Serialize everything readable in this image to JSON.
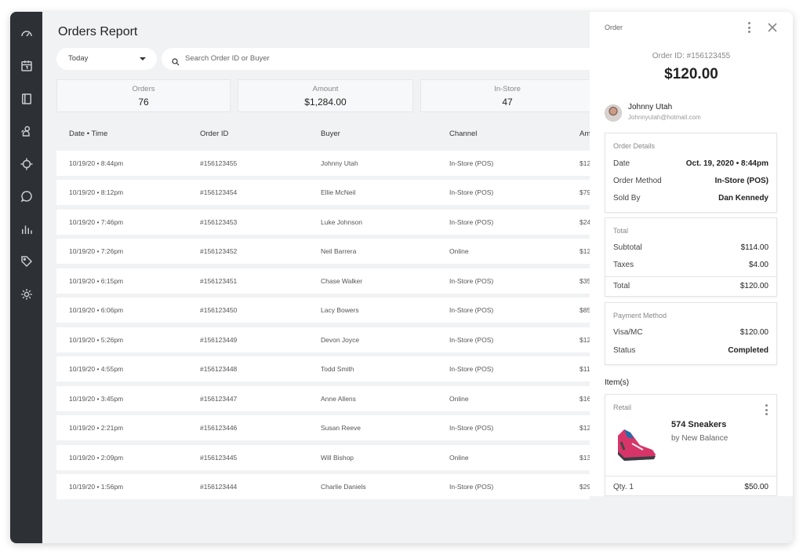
{
  "sidebar": {
    "items": [
      {
        "icon": "dashboard-icon"
      },
      {
        "icon": "calendar-icon"
      },
      {
        "icon": "book-icon"
      },
      {
        "icon": "users-icon"
      },
      {
        "icon": "target-icon"
      },
      {
        "icon": "chat-icon"
      },
      {
        "icon": "bar-chart-icon"
      },
      {
        "icon": "tag-icon"
      },
      {
        "icon": "gear-icon"
      }
    ]
  },
  "page": {
    "title": "Orders Report",
    "date_filter": "Today",
    "search_placeholder": "Search Order ID or Buyer"
  },
  "stats": [
    {
      "label": "Orders",
      "value": "76"
    },
    {
      "label": "Amount",
      "value": "$1,284.00"
    },
    {
      "label": "In-Store",
      "value": "47"
    }
  ],
  "table": {
    "columns": [
      "Date • Time",
      "Order ID",
      "Buyer",
      "Channel",
      "Am"
    ],
    "rows": [
      {
        "datetime": "10/19/20 • 8:44pm",
        "order_id": "#156123455",
        "buyer": "Johnny Utah",
        "channel": "In-Store (POS)",
        "amount": "$12"
      },
      {
        "datetime": "10/19/20 • 8:12pm",
        "order_id": "#156123454",
        "buyer": "Ellie McNeil",
        "channel": "In-Store (POS)",
        "amount": "$79"
      },
      {
        "datetime": "10/19/20 • 7:46pm",
        "order_id": "#156123453",
        "buyer": "Luke Johnson",
        "channel": "In-Store (POS)",
        "amount": "$24"
      },
      {
        "datetime": "10/19/20 • 7:26pm",
        "order_id": "#156123452",
        "buyer": "Neil Barrera",
        "channel": "Online",
        "amount": "$12"
      },
      {
        "datetime": "10/19/20 • 6:15pm",
        "order_id": "#156123451",
        "buyer": "Chase Walker",
        "channel": "In-Store (POS)",
        "amount": "$35"
      },
      {
        "datetime": "10/19/20 • 6:06pm",
        "order_id": "#156123450",
        "buyer": "Lacy Bowers",
        "channel": "In-Store (POS)",
        "amount": "$85"
      },
      {
        "datetime": "10/19/20 • 5:26pm",
        "order_id": "#156123449",
        "buyer": "Devon Joyce",
        "channel": "In-Store (POS)",
        "amount": "$12"
      },
      {
        "datetime": "10/19/20 • 4:55pm",
        "order_id": "#156123448",
        "buyer": "Todd Smith",
        "channel": "In-Store (POS)",
        "amount": "$11"
      },
      {
        "datetime": "10/19/20 • 3:45pm",
        "order_id": "#156123447",
        "buyer": "Anne Allens",
        "channel": "Online",
        "amount": "$16"
      },
      {
        "datetime": "10/19/20 • 2:21pm",
        "order_id": "#156123446",
        "buyer": "Susan Reeve",
        "channel": "In-Store (POS)",
        "amount": "$12"
      },
      {
        "datetime": "10/19/20 • 2:09pm",
        "order_id": "#156123445",
        "buyer": "Will Bishop",
        "channel": "Online",
        "amount": "$13"
      },
      {
        "datetime": "10/19/20 • 1:56pm",
        "order_id": "#156123444",
        "buyer": "Charlie Daniels",
        "channel": "In-Store (POS)",
        "amount": "$29"
      }
    ]
  },
  "panel": {
    "header": "Order",
    "order_id": "Order ID: #156123455",
    "total": "$120.00",
    "customer": {
      "name": "Johnny Utah",
      "email": "Johnnyutah@hotmail.com"
    },
    "details": {
      "title": "Order Details",
      "date_label": "Date",
      "date_value": "Oct. 19, 2020 • 8:44pm",
      "method_label": "Order Method",
      "method_value": "In-Store (POS)",
      "soldby_label": "Sold By",
      "soldby_value": "Dan Kennedy"
    },
    "totals": {
      "title": "Total",
      "subtotal_label": "Subtotal",
      "subtotal_value": "$114.00",
      "taxes_label": "Taxes",
      "taxes_value": "$4.00",
      "total_label": "Total",
      "total_value": "$120.00"
    },
    "payment": {
      "title": "Payment Method",
      "method_label": "Visa/MC",
      "method_value": "$120.00",
      "status_label": "Status",
      "status_value": "Completed"
    },
    "items_label": "Item(s)",
    "item": {
      "category": "Retail",
      "name": "574 Sneakers",
      "brand": "by New Balance",
      "qty": "Qty. 1",
      "price": "$50.00"
    }
  }
}
